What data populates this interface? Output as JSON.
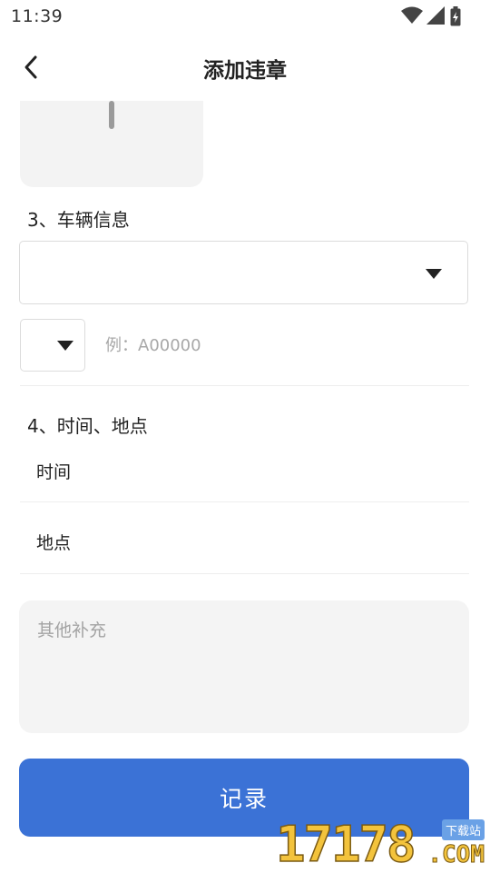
{
  "status_bar": {
    "time": "11:39"
  },
  "header": {
    "title": "添加违章"
  },
  "vehicle_section": {
    "title": "3、车辆信息",
    "vehicle_value": "",
    "plate_prefix_value": "",
    "plate_placeholder": "例：A00000"
  },
  "time_place_section": {
    "title": "4、时间、地点",
    "time_label": "时间",
    "place_label": "地点"
  },
  "notes": {
    "placeholder": "其他补充"
  },
  "record_button": {
    "label": "记录"
  },
  "watermark": {
    "number": "17178",
    "badge": "下载站",
    "suffix": ".COM"
  },
  "colors": {
    "primary": "#3b72d6",
    "input_bg": "#f4f4f4",
    "border": "#dcdcdc"
  }
}
